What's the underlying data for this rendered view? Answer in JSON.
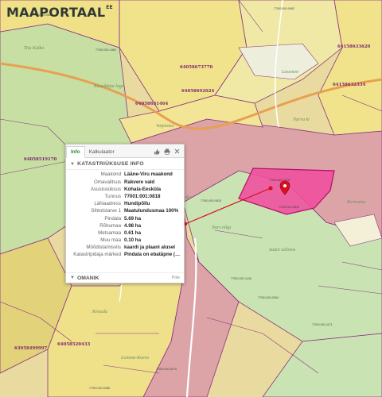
{
  "app": {
    "logo_text": "MAAPORTAAL",
    "logo_suffix": "EE",
    "brand_color": "#2d8a3e"
  },
  "map": {
    "colors": {
      "field_yellow": "#f0e28a",
      "forest_green": "#bfe0a0",
      "land_pink": "#dba0a8",
      "selected_parcel": "#f060b0",
      "road_orange": "#e8a050",
      "boundary_purple": "#8a3080",
      "marker_red": "#d81020"
    },
    "parcel_numbers": [
      "64058673770",
      "64058692024",
      "64058631464",
      "64058519170",
      "64158633620",
      "64158632334",
      "63958499997",
      "64058520433"
    ],
    "cadastral_labels": [
      "77001:001:0817",
      "77002:001:0962",
      "77002:001:1982",
      "77001:001:0818",
      "77002:001:0810",
      "77001:001:0815",
      "77001:001:0354",
      "77001:001:1171",
      "77001:001:0286",
      "77001:001:0270",
      "77001:001:1146"
    ],
    "place_names": [
      "Tiiu Kalka",
      "Kuusikäpa lage",
      "Vaipiotsa",
      "Lassmen",
      "Narva kr",
      "Kasiku",
      "Nurs nõgs",
      "Saare seltsiva",
      "Kivaala",
      "Lomma-Koera",
      "Kerivatsa"
    ]
  },
  "popup": {
    "tabs": [
      {
        "label": "Info",
        "active": true
      },
      {
        "label": "Kalkulaator",
        "active": false
      }
    ],
    "tools": [
      "thumbs-up-icon",
      "print-icon",
      "close-icon"
    ],
    "section_title": "KATASTRIÜKSUSE INFO",
    "rows": [
      {
        "key": "Maakond",
        "value": "Lääne-Viru maakond"
      },
      {
        "key": "Omavalitsus",
        "value": "Rakvere vald"
      },
      {
        "key": "Asustusüksus",
        "value": "Kohala-Eesküla"
      },
      {
        "key": "Tunnus",
        "value": "77001:001:0818"
      },
      {
        "key": "Lähiaadress",
        "value": "Hundipõllu"
      },
      {
        "key": "Sihtotstarve 1",
        "value": "Maatulundusmaa 100%"
      },
      {
        "key": "Pindala",
        "value": "5.69 ha"
      },
      {
        "key": "Rõhumaa",
        "value": "4.98 ha"
      },
      {
        "key": "Metsamaa",
        "value": "0.61 ha"
      },
      {
        "key": "Muu maa",
        "value": "0.10 ha"
      },
      {
        "key": "Mõõdistamisviis",
        "value": "kaardi ja plaani alusel"
      },
      {
        "key": "Katastripidaja märked",
        "value": "Pindala on ebatäpne (…"
      }
    ],
    "footer_title": "OMANIK",
    "footer_link": "Pole"
  }
}
